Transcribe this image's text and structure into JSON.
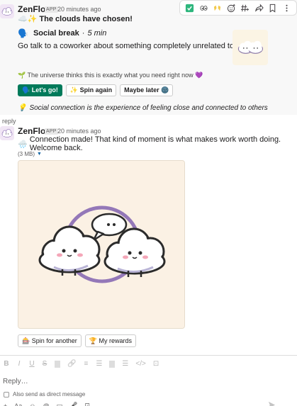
{
  "toolbar": {
    "icons": [
      "check-icon",
      "eyes-icon",
      "clap-icon",
      "add-reaction-icon",
      "hash-icon",
      "share-icon",
      "bookmark-icon",
      "more-icon"
    ]
  },
  "message1": {
    "sender": "ZenFlow",
    "badge": "APP",
    "time": "20 minutes ago",
    "headline": "☁️✨ The clouds have chosen!",
    "break_emoji": "🗣️",
    "break_title": "Social break",
    "break_sep": "·",
    "break_duration": "5 min",
    "description": "Go talk to a coworker about something completely unrelated to work.",
    "universe_text": "🌱 The universe thinks this is exactly what you need right now 💜",
    "buttons": {
      "go": "🗣️ Let's go!",
      "spin": "✨ Spin again",
      "later": "Maybe later 🌚"
    },
    "quote_emoji": "💡",
    "quote": "Social connection is the experience of feeling close and connected to others"
  },
  "reply_label": "reply",
  "message2": {
    "sender": "ZenFlow",
    "badge": "APP",
    "time": "20 minutes ago",
    "emoji": "🌧️",
    "text": "Connection made! That kind of moment is what makes work worth doing. Welcome back.",
    "file_size": "(3 MB)",
    "buttons": {
      "spin_another": "🎰 Spin for another",
      "rewards": "🏆 My rewards"
    }
  },
  "composer": {
    "format_buttons": [
      "B",
      "I",
      "U",
      "S",
      "🔗",
      "≡",
      "☰",
      "☰",
      "</>",
      "⊡"
    ],
    "placeholder": "Reply…",
    "dm_label": "Also send as direct message",
    "bottom_icons": [
      "+",
      "Aa",
      "☺",
      "@",
      "▭",
      "🎤",
      "⊡"
    ]
  }
}
